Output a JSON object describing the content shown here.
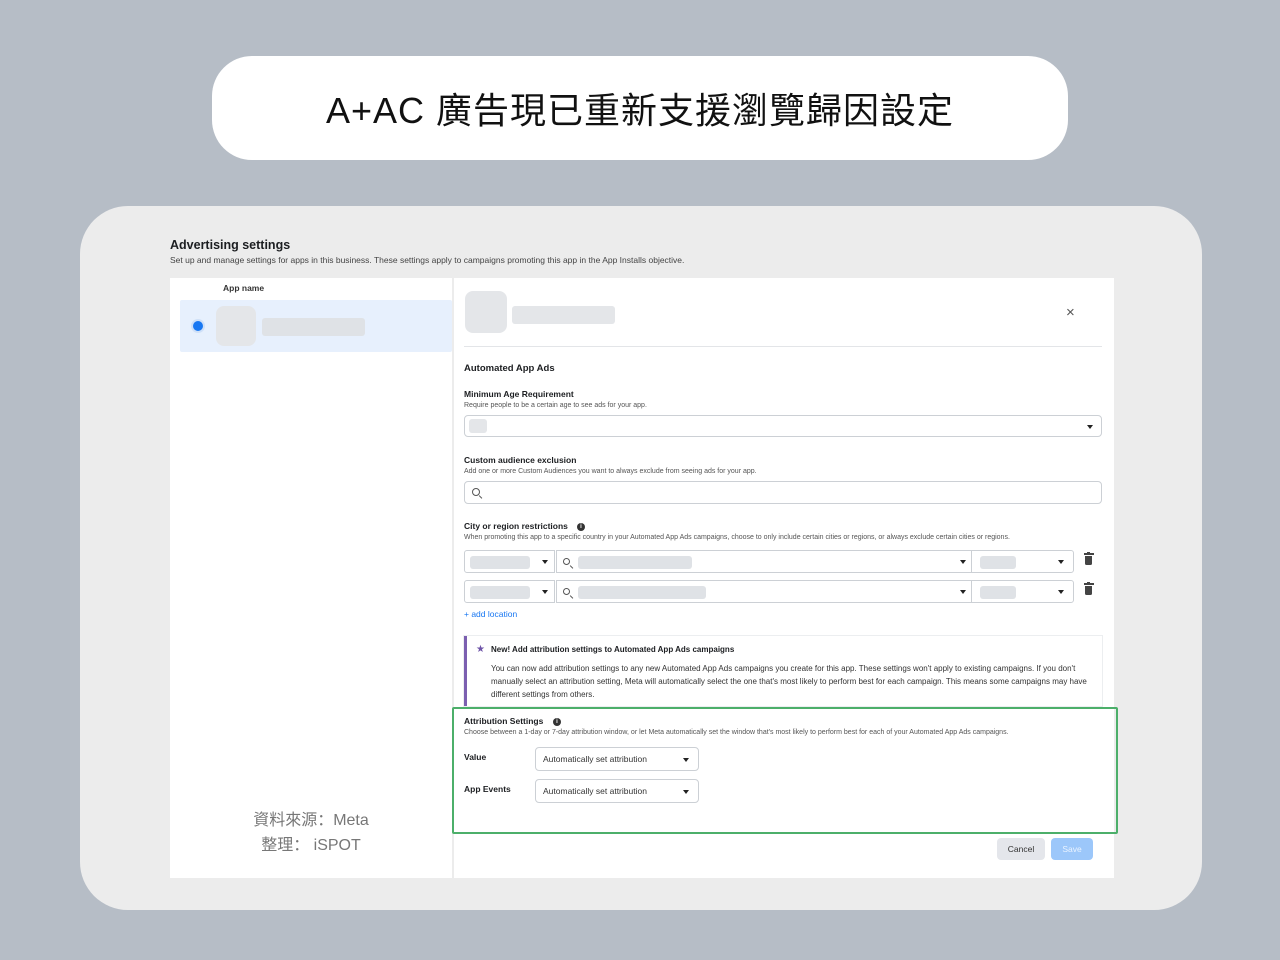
{
  "banner": {
    "title": "A+AC 廣告現已重新支援瀏覽歸因設定"
  },
  "settings": {
    "title": "Advertising settings",
    "description": "Set up and manage settings for apps in this business. These settings apply to campaigns promoting this app in the App Installs objective."
  },
  "app_list": {
    "header": "App name",
    "source_line1": "資料來源：Meta",
    "source_line2": "整理： iSPOT"
  },
  "panel": {
    "close_glyph": "×",
    "section_title": "Automated App Ads",
    "min_age": {
      "label": "Minimum Age Requirement",
      "description": "Require people to be a certain age to see ads for your app."
    },
    "custom_audience": {
      "label": "Custom audience exclusion",
      "description": "Add one or more Custom Audiences you want to always exclude from seeing ads for your app."
    },
    "city_region": {
      "label": "City or region restrictions",
      "info_glyph": "i",
      "description": "When promoting this app to a specific country in your Automated App Ads campaigns, choose to only include certain cities or regions, or always exclude certain cities or regions.",
      "add_location": "+ add location"
    },
    "notice": {
      "star_glyph": "★",
      "title": "New! Add attribution settings to Automated App Ads campaigns",
      "body": "You can now add attribution settings to any new Automated App Ads campaigns you create for this app. These settings won't apply to existing campaigns. If you don't manually select an attribution setting, Meta will automatically select the one that's most likely to perform best for each campaign. This means some campaigns may have different settings from others."
    },
    "attribution": {
      "label": "Attribution Settings",
      "info_glyph": "i",
      "description": "Choose between a 1-day or 7-day attribution window, or let Meta automatically set the window that's most likely to perform best for each of your Automated App Ads campaigns.",
      "value_label": "Value",
      "value_selected": "Automatically set attribution",
      "events_label": "App Events",
      "events_selected": "Automatically set attribution"
    },
    "buttons": {
      "cancel": "Cancel",
      "save": "Save"
    }
  },
  "colors": {
    "background": "#b6bdc6",
    "accent_blue": "#1877f2",
    "highlight_green": "#4caf6a",
    "notice_purple": "#7b5fb0"
  }
}
